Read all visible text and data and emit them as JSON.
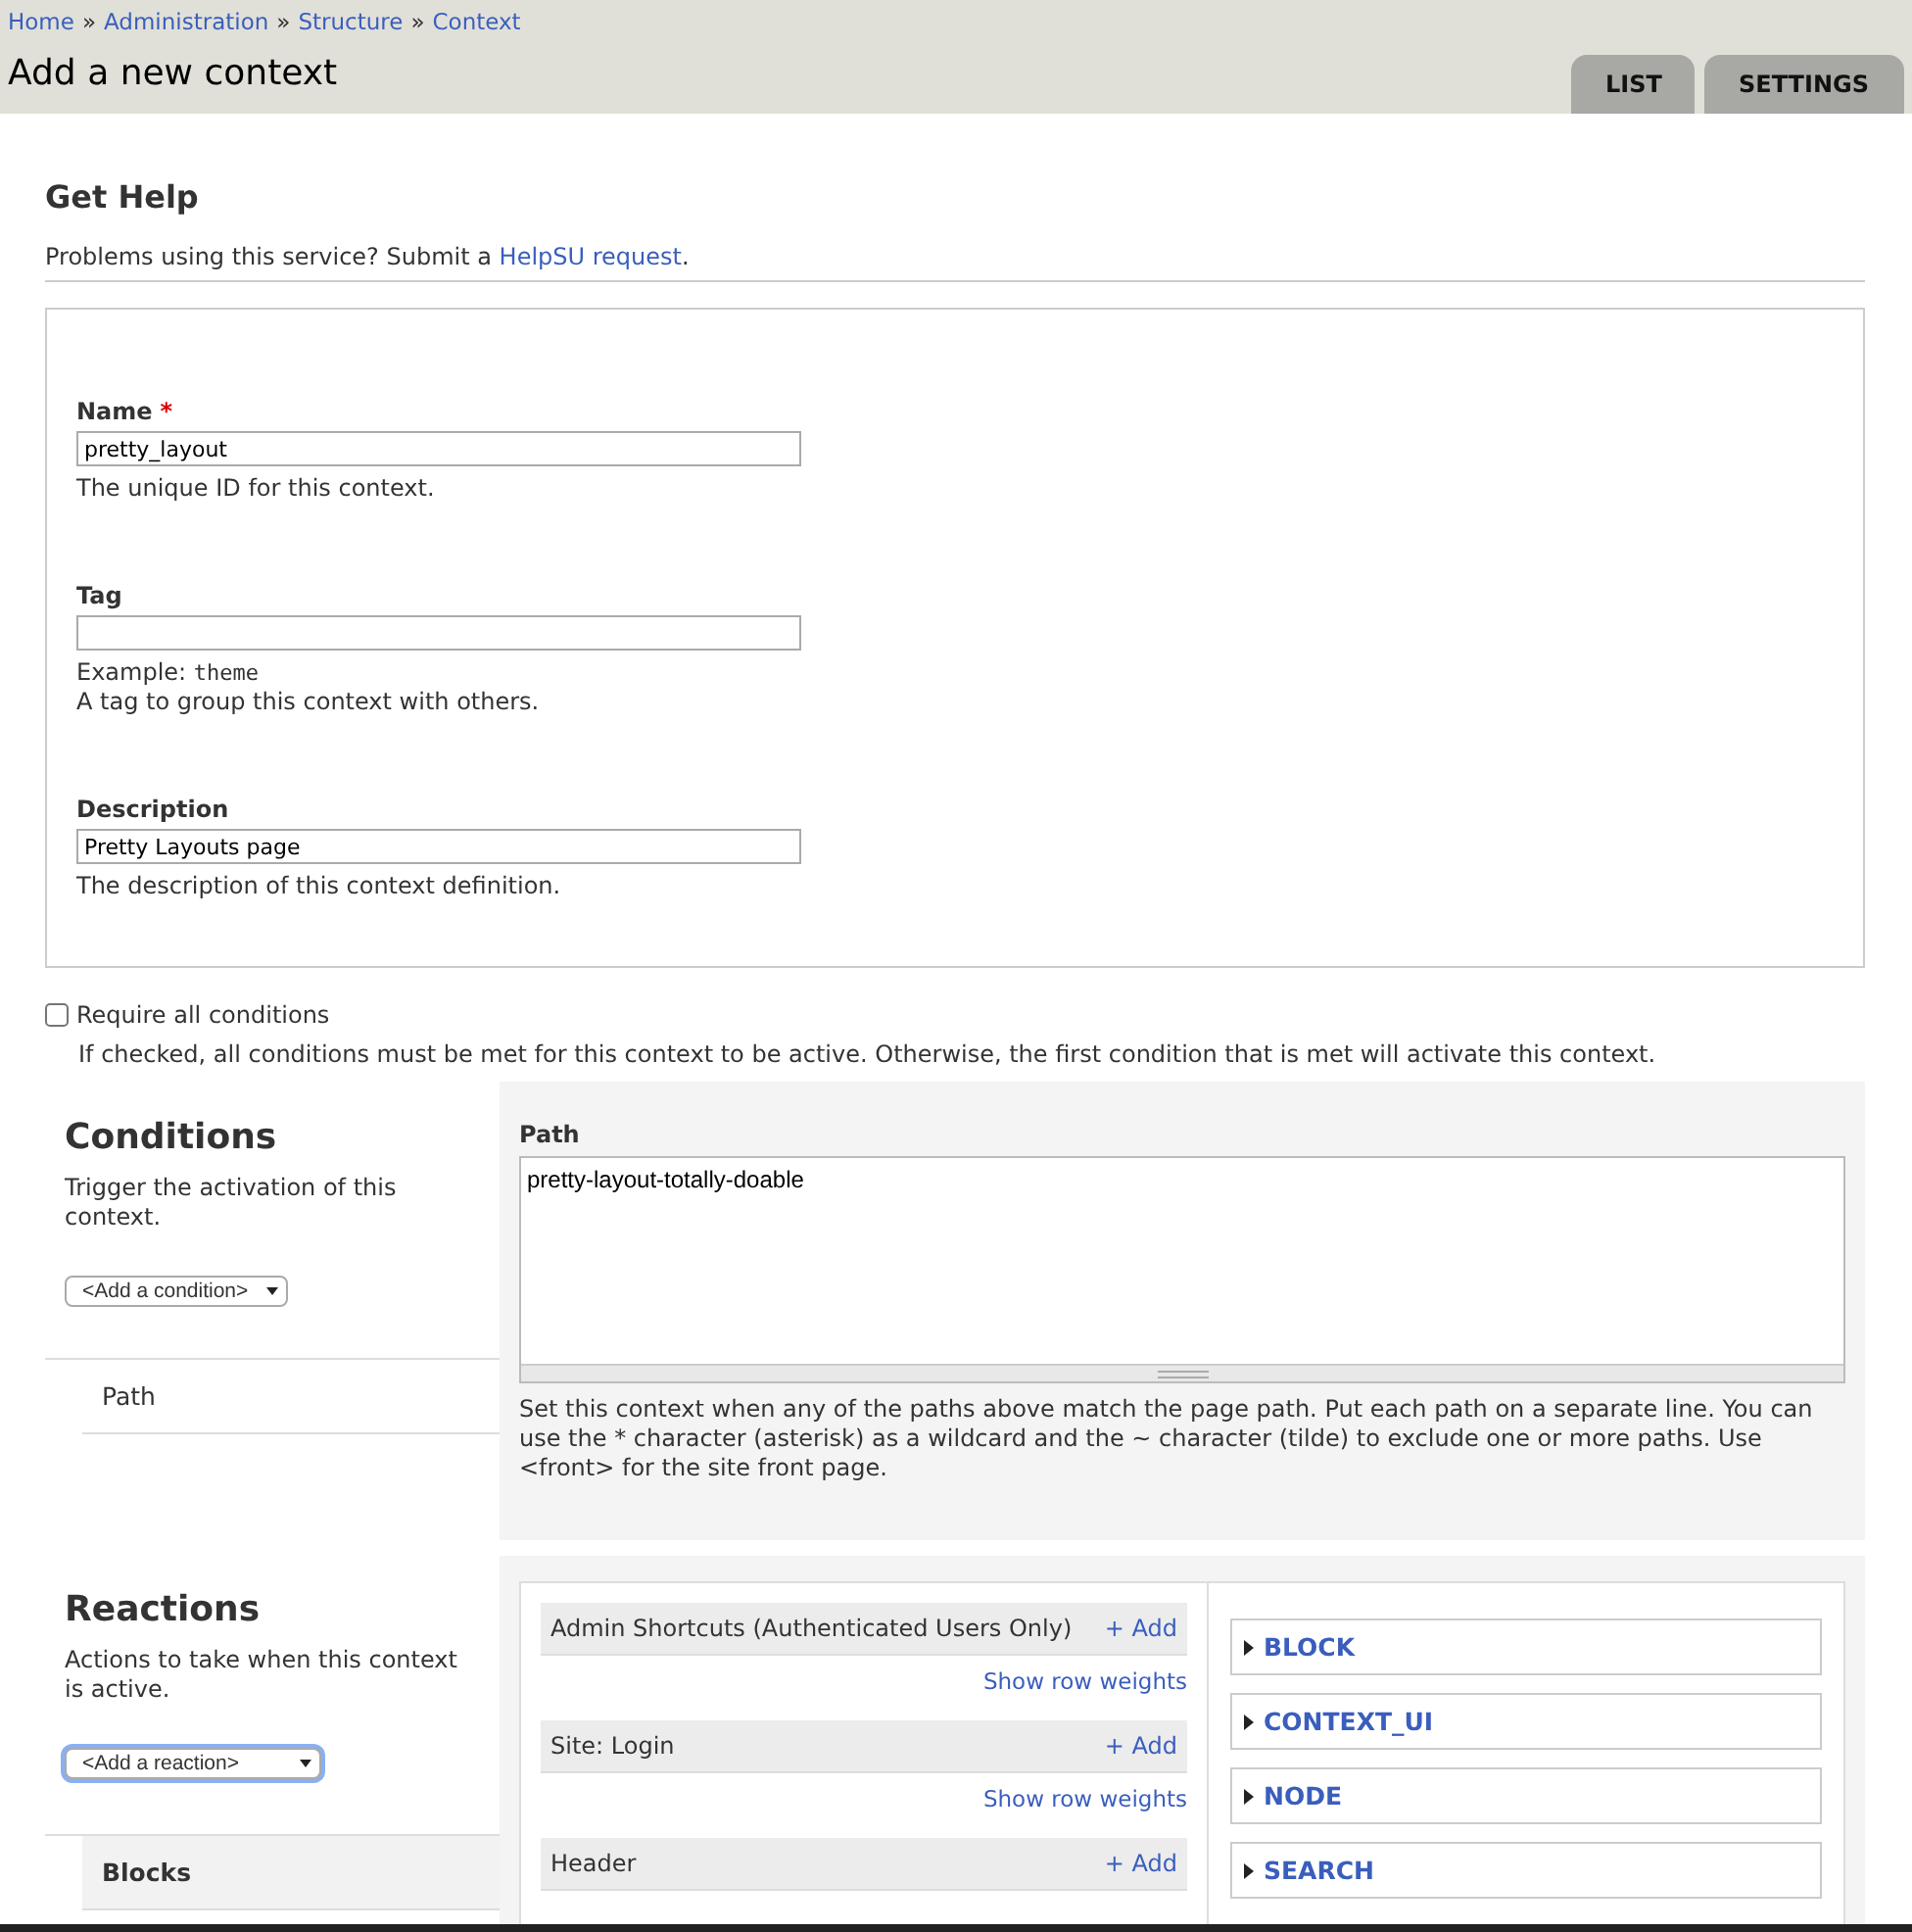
{
  "breadcrumb": [
    "Home",
    "Administration",
    "Structure",
    "Context"
  ],
  "breadcrumb_separator": "»",
  "page_title": "Add a new context",
  "tabs": [
    {
      "label": "LIST",
      "selected": false
    },
    {
      "label": "SETTINGS",
      "selected": false
    }
  ],
  "help": {
    "title": "Get Help",
    "text": "Problems using this service? Submit a ",
    "link": "HelpSU request",
    "after": "."
  },
  "fields": [
    {
      "label": "Name",
      "required_mark": "*",
      "value": "pretty_layout",
      "descriptions": [
        "The unique ID for this context."
      ]
    },
    {
      "label": "Tag",
      "example_label": "Example: ",
      "example_code": "theme",
      "descriptions": [
        "A tag to group this context with others."
      ]
    },
    {
      "label": "Description",
      "value": "Pretty Layouts page",
      "descriptions": [
        "The description of this context definition."
      ]
    }
  ],
  "require_all": {
    "label": "Require all conditions",
    "checked": false,
    "description": "If checked, all conditions must be met for this context to be active. Otherwise, the first condition that is met will activate this context."
  },
  "conditions": {
    "title": "Conditions",
    "description": "Trigger the activation of this context.",
    "select": "<Add a condition>",
    "items": [
      {
        "label": "Path",
        "selected": false
      }
    ],
    "path_label": "Path",
    "path_value": "pretty-layout-totally-doable",
    "path_help": "Set this context when any of the paths above match the page path. Put each path on a separate line. You can use the * character (asterisk) as a wildcard and the ~ character (tilde) to exclude one or more paths. Use <front> for the site front page."
  },
  "reactions": {
    "title": "Reactions",
    "description": "Actions to take when this context is active.",
    "select": "<Add a reaction>",
    "items": [
      {
        "label": "Blocks",
        "selected": true
      }
    ],
    "regions": [
      {
        "name": "Admin Shortcuts (Authenticated Users Only)",
        "add": "+ Add",
        "weights": "Show row weights"
      },
      {
        "name": "Site: Login",
        "add": "+ Add",
        "weights": "Show row weights"
      },
      {
        "name": "Header",
        "add": "+ Add"
      }
    ],
    "groups": [
      "BLOCK",
      "CONTEXT_UI",
      "NODE",
      "SEARCH"
    ]
  }
}
